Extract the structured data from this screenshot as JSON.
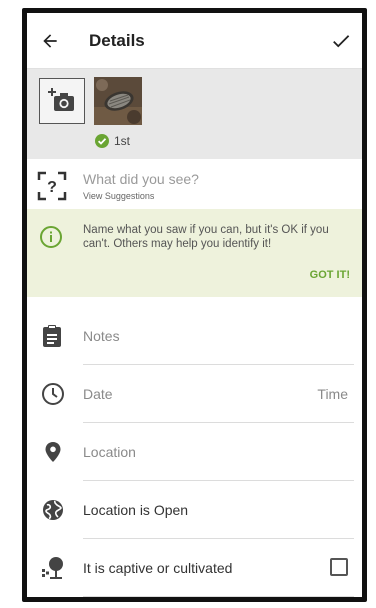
{
  "appbar": {
    "title": "Details"
  },
  "photos": {
    "badge_label": "1st"
  },
  "identification": {
    "placeholder": "What did you see?",
    "suggestions_label": "View Suggestions"
  },
  "hint": {
    "text": "Name what you saw if you can, but it's OK if you can't. Others may help you identify it!",
    "dismiss_label": "GOT IT!"
  },
  "fields": {
    "notes_placeholder": "Notes",
    "date_label": "Date",
    "time_label": "Time",
    "location_label": "Location",
    "geoprivacy_label": "Location is Open",
    "captive_label": "It is captive or cultivated",
    "captive_checked": false
  },
  "colors": {
    "accent_green": "#6aa533",
    "hint_bg": "#eef2dc",
    "photo_strip_bg": "#e8e8e8"
  }
}
